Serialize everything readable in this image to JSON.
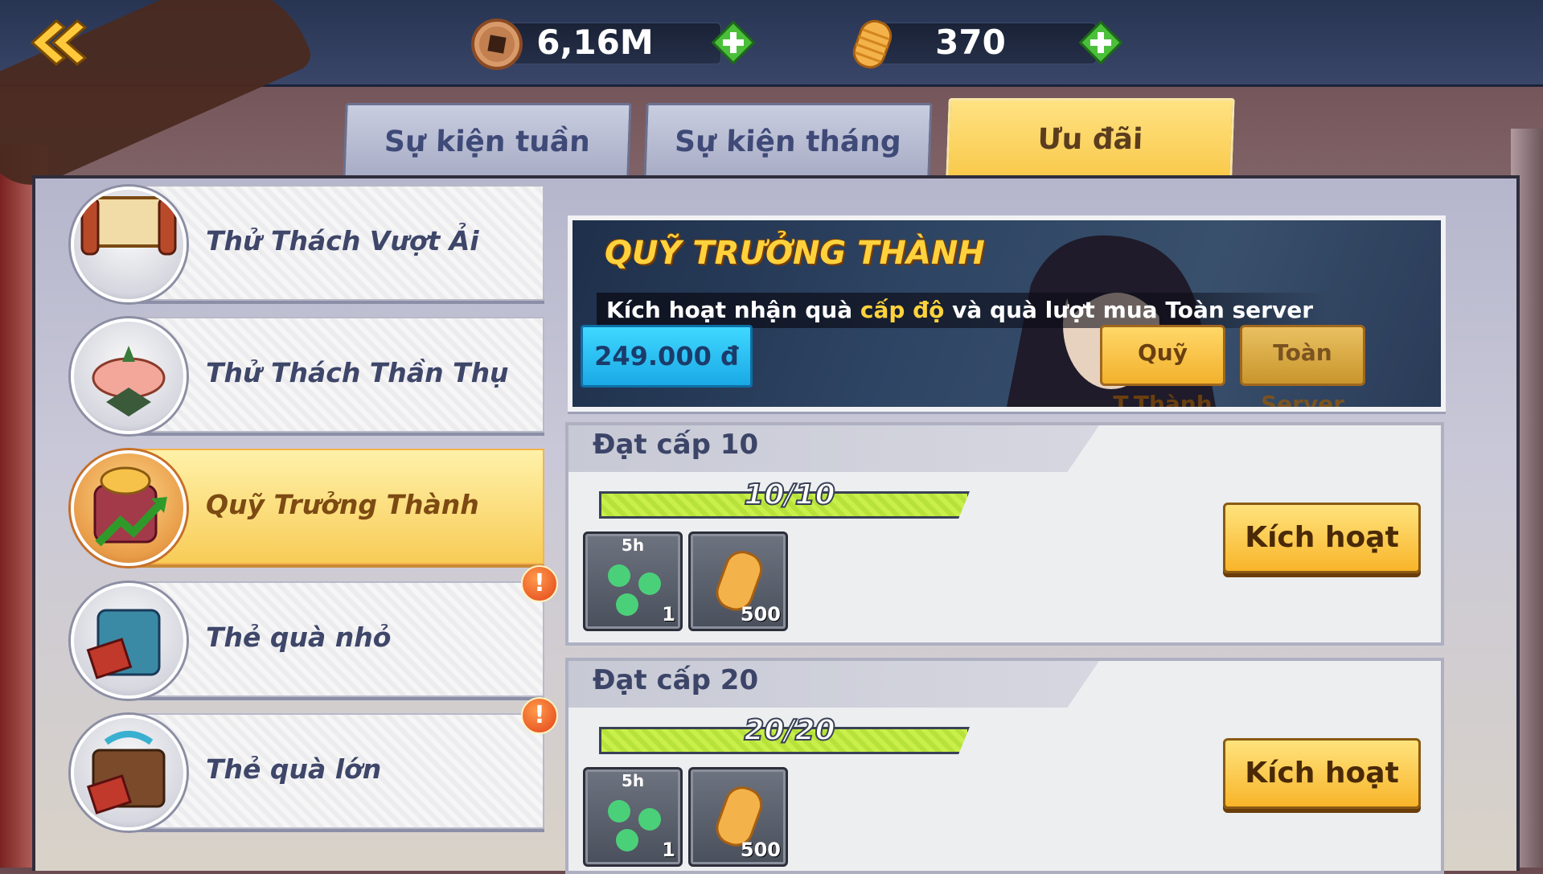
{
  "resources": {
    "copper": {
      "value": "6,16M",
      "icon": "copper-coin-icon"
    },
    "gold": {
      "value": "370",
      "icon": "gold-ingot-icon"
    }
  },
  "tabs": [
    {
      "label": "Sự kiện tuần",
      "active": false
    },
    {
      "label": "Sự kiện tháng",
      "active": false
    },
    {
      "label": "Ưu đãi",
      "active": true
    }
  ],
  "menu": [
    {
      "label": "Thử Thách Vượt Ải",
      "icon": "scroll-icon",
      "active": false,
      "alert": false
    },
    {
      "label": "Thử Thách Thần Thụ",
      "icon": "sacred-tree-icon",
      "active": false,
      "alert": false
    },
    {
      "label": "Quỹ Trưởng Thành",
      "icon": "growth-fund-icon",
      "active": true,
      "alert": false
    },
    {
      "label": "Thẻ quà nhỏ",
      "icon": "small-gift-card-icon",
      "active": false,
      "alert": true
    },
    {
      "label": "Thẻ quà lớn",
      "icon": "large-gift-card-icon",
      "active": false,
      "alert": true
    }
  ],
  "banner": {
    "title": "QUỸ TRƯỞNG THÀNH",
    "subtitle_parts": [
      "Kích hoạt nhận quà ",
      "cấp độ",
      " và quà lượt mua Toàn server"
    ],
    "price": "249.000 đ",
    "btn_fund": "Quỹ T.Thành",
    "btn_server": "Toàn Server"
  },
  "levels": [
    {
      "title": "Đạt cấp 10",
      "progress_text": "10/10",
      "progress": 1.0,
      "items": [
        {
          "time": "5h",
          "count": "1",
          "icon": "green-magatama-icon"
        },
        {
          "count": "500",
          "icon": "gold-ingot-icon"
        }
      ],
      "button": "Kích hoạt"
    },
    {
      "title": "Đạt cấp 20",
      "progress_text": "20/20",
      "progress": 1.0,
      "items": [
        {
          "time": "5h",
          "count": "1",
          "icon": "green-magatama-icon"
        },
        {
          "count": "500",
          "icon": "gold-ingot-icon"
        }
      ],
      "button": "Kích hoạt"
    }
  ],
  "alert_mark": "!",
  "colors": {
    "accent": "#f9c94a",
    "price": "#1aa9e6",
    "progress": "#c9ef4a"
  }
}
